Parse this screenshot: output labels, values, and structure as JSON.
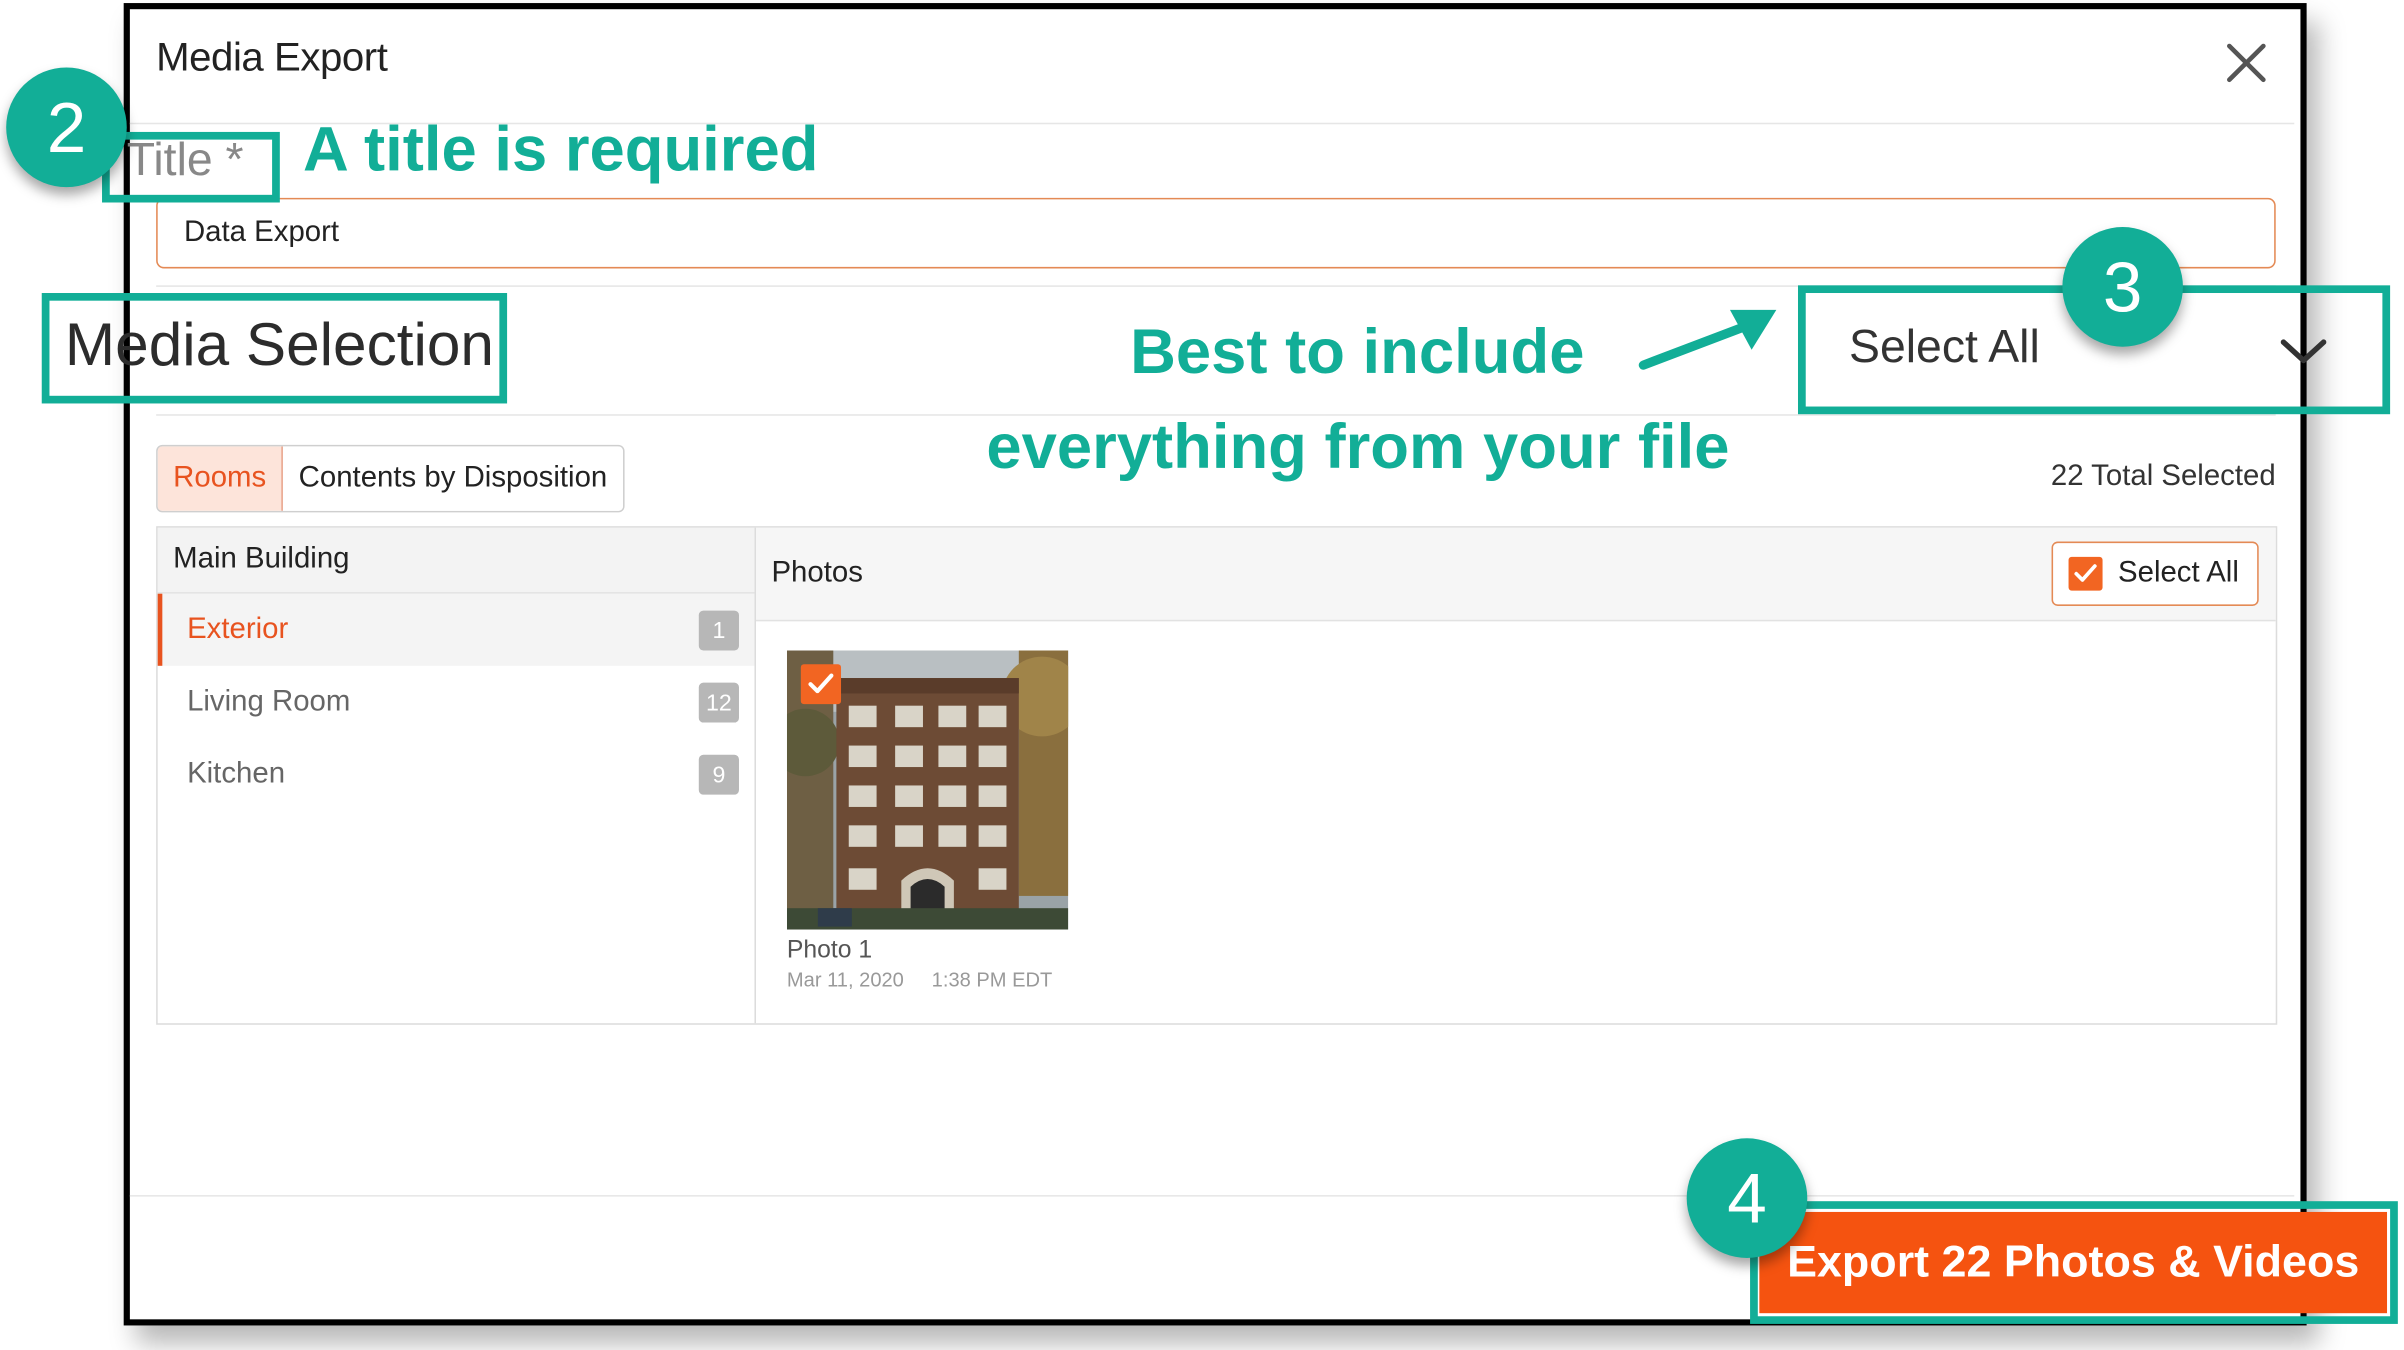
{
  "modal": {
    "title": "Media Export",
    "close_icon": "close-icon",
    "title_label": "Title *",
    "title_value": "Data Export",
    "section_heading": "Media Selection",
    "selection_mode": "Select All",
    "tabs": [
      {
        "label": "Rooms",
        "active": true
      },
      {
        "label": "Contents by Disposition",
        "active": false
      }
    ],
    "total_selected": "22 Total Selected",
    "group": "Main Building",
    "rooms": [
      {
        "label": "Exterior",
        "count": "1",
        "active": true
      },
      {
        "label": "Living Room",
        "count": "12",
        "active": false
      },
      {
        "label": "Kitchen",
        "count": "9",
        "active": false
      }
    ],
    "photos_heading": "Photos",
    "select_all_label": "Select All",
    "photo": {
      "name": "Photo 1",
      "date": "Mar 11, 2020",
      "time": "1:38 PM EDT"
    },
    "export_button": "Export 22 Photos & Videos"
  },
  "annotations": {
    "step2": "2",
    "step3": "3",
    "step4": "4",
    "note_title": "A title is required",
    "note_select_line1": "Best to include",
    "note_select_line2": "everything from your file"
  },
  "colors": {
    "accent": "#f26522",
    "annotation": "#12ae97"
  }
}
